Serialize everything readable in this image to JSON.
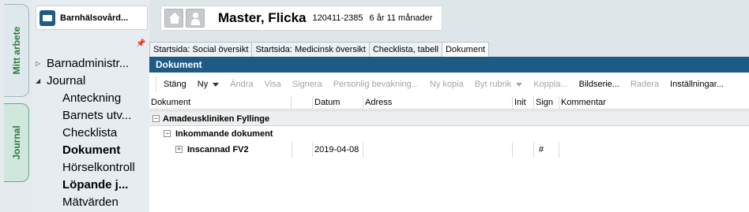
{
  "side_tabs": [
    "Mitt arbete",
    "Journal"
  ],
  "unit": {
    "label": "Barnhälsovård..."
  },
  "tree": [
    {
      "label": "Barnadministr...",
      "level": 0,
      "arrow": "▷",
      "bold": false
    },
    {
      "label": "Journal",
      "level": 0,
      "arrow": "◢",
      "bold": false
    },
    {
      "label": "Anteckning",
      "level": 1,
      "bold": false
    },
    {
      "label": "Barnets utv...",
      "level": 1,
      "bold": false
    },
    {
      "label": "Checklista",
      "level": 1,
      "bold": false
    },
    {
      "label": "Dokument",
      "level": 1,
      "bold": true
    },
    {
      "label": "Hörselkontroll",
      "level": 1,
      "bold": false
    },
    {
      "label": "Löpande j...",
      "level": 1,
      "bold": true
    },
    {
      "label": "Mätvärden",
      "level": 1,
      "bold": false
    }
  ],
  "patient": {
    "name": "Master, Flicka",
    "id": "120411-2385",
    "age": "6 år 11 månader"
  },
  "tabs": [
    "Startsida: Social översikt",
    "Startsida: Medicinsk översikt",
    "Checklista, tabell",
    "Dokument"
  ],
  "panel_title": "Dokument",
  "toolbar": [
    {
      "label": "Stäng",
      "enabled": true
    },
    {
      "label": "Ny",
      "enabled": true,
      "dropdown": true
    },
    {
      "label": "Ändra",
      "enabled": false
    },
    {
      "label": "Visa",
      "enabled": false
    },
    {
      "label": "Signera",
      "enabled": false
    },
    {
      "label": "Personlig bevakning...",
      "enabled": false
    },
    {
      "label": "Ny kopia",
      "enabled": false
    },
    {
      "label": "Byt rubrik",
      "enabled": false,
      "dropdown": true
    },
    {
      "label": "Koppla...",
      "enabled": false
    },
    {
      "label": "Bildserie...",
      "enabled": true
    },
    {
      "label": "Radera",
      "enabled": false
    },
    {
      "label": "Inställningar...",
      "enabled": true
    }
  ],
  "columns": [
    "Dokument",
    "Datum",
    "Adress",
    "Init",
    "Sign",
    "Kommentar"
  ],
  "groups": {
    "level1": "Amadeuskliniken Fyllinge",
    "level2": "Inkommande dokument"
  },
  "rows": [
    {
      "dokument": "Inscannad FV2",
      "datum": "2019-04-08",
      "adress": "",
      "init": "",
      "sign": "#",
      "kommentar": ""
    }
  ],
  "colors": {
    "accent": "#1d5a84",
    "tab_green": "#2e7d3f"
  }
}
